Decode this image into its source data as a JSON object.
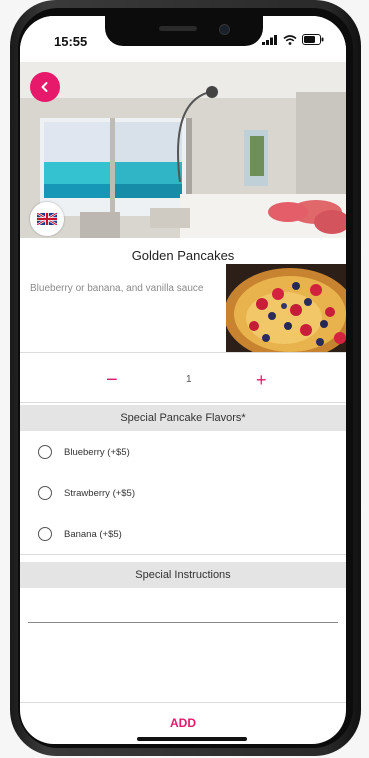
{
  "status_bar": {
    "time": "15:55"
  },
  "product": {
    "title": "Golden Pancakes",
    "description": "Blueberry or banana, and vanilla sauce"
  },
  "quantity": {
    "minus": "−",
    "value": "1",
    "plus": "+"
  },
  "flavors": {
    "header": "Special Pancake Flavors*",
    "options": [
      {
        "label": "Blueberry (+$5)"
      },
      {
        "label": "Strawberry (+$5)"
      },
      {
        "label": "Banana (+$5)"
      }
    ]
  },
  "instructions": {
    "header": "Special Instructions"
  },
  "footer": {
    "add_label": "ADD"
  },
  "colors": {
    "accent": "#e6196a",
    "section_bg": "#e4e4e4"
  },
  "icons": {
    "back": "chevron-left-icon",
    "language": "uk-flag-icon"
  }
}
